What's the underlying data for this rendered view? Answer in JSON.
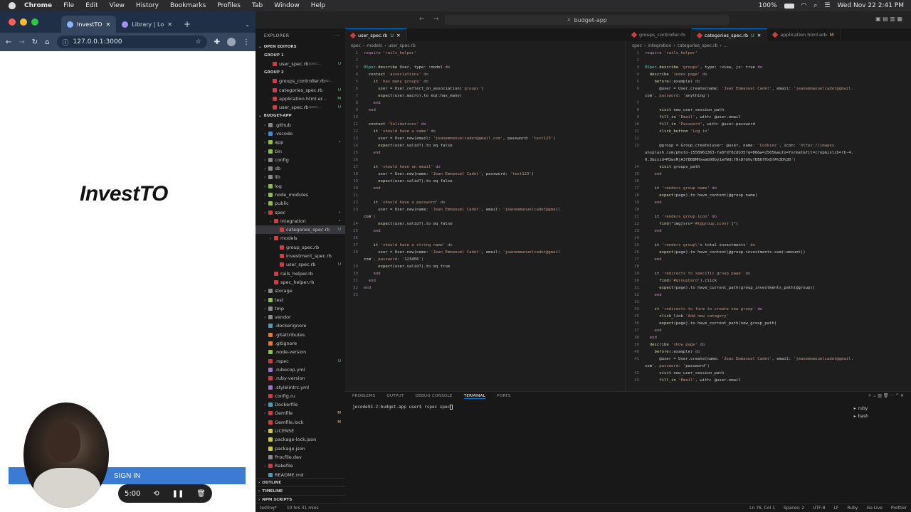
{
  "menubar": {
    "app": "Chrome",
    "items": [
      "File",
      "Edit",
      "View",
      "History",
      "Bookmarks",
      "Profiles",
      "Tab",
      "Window",
      "Help"
    ],
    "battery": "100%",
    "datetime": "Wed Nov 22  2:41 PM"
  },
  "chrome": {
    "tabs": [
      {
        "label": "InvestTO",
        "active": true
      },
      {
        "label": "Library | Lo",
        "active": false
      }
    ],
    "url": "127.0.0.1:3000",
    "page": {
      "brand": "InvestTO",
      "signin_label": "SIGN IN"
    }
  },
  "recorder": {
    "time": "5:00"
  },
  "vscode": {
    "window_title": "budget-app",
    "explorer_title": "EXPLORER",
    "open_editors_title": "OPEN EDITORS",
    "groups": [
      {
        "title": "GROUP 1",
        "files": [
          {
            "name": "user_spec.rb",
            "hint": "spec/...",
            "badge": "U"
          }
        ]
      },
      {
        "title": "GROUP 2",
        "files": [
          {
            "name": "groups_controller.rb",
            "hint": "ap...",
            "badge": ""
          },
          {
            "name": "categories_spec.rb",
            "hint": "",
            "badge": "U"
          },
          {
            "name": "application.html.er...",
            "hint": "",
            "badge": "M"
          },
          {
            "name": "user_spec.rb",
            "hint": "spec/...",
            "badge": "U"
          }
        ]
      }
    ],
    "project_title": "BUDGET-APP",
    "tree": [
      {
        "name": ".github",
        "indent": 1,
        "color": "#8a8a8a",
        "badge": ""
      },
      {
        "name": ".vscode",
        "indent": 1,
        "color": "#3f8fd6",
        "badge": ""
      },
      {
        "name": "app",
        "indent": 1,
        "color": "#8dc149",
        "badge": "•"
      },
      {
        "name": "bin",
        "indent": 1,
        "color": "#8dc149",
        "badge": ""
      },
      {
        "name": "config",
        "indent": 1,
        "color": "#8a8a8a",
        "badge": ""
      },
      {
        "name": "db",
        "indent": 1,
        "color": "#8a8a8a",
        "badge": ""
      },
      {
        "name": "lib",
        "indent": 1,
        "color": "#8a8a8a",
        "badge": ""
      },
      {
        "name": "log",
        "indent": 1,
        "color": "#8dc149",
        "badge": ""
      },
      {
        "name": "node_modules",
        "indent": 1,
        "color": "#8dc149",
        "badge": ""
      },
      {
        "name": "public",
        "indent": 1,
        "color": "#8dc149",
        "badge": ""
      },
      {
        "name": "spec",
        "indent": 1,
        "color": "#cc3e44",
        "badge": "•"
      },
      {
        "name": "integration",
        "indent": 2,
        "color": "#cc3e44",
        "badge": "•"
      },
      {
        "name": "categories_spec.rb",
        "indent": 3,
        "color": "#cc3e44",
        "badge": "U",
        "selected": true
      },
      {
        "name": "models",
        "indent": 2,
        "color": "#cc3e44",
        "badge": ""
      },
      {
        "name": "group_spec.rb",
        "indent": 3,
        "color": "#cc3e44",
        "badge": ""
      },
      {
        "name": "investment_spec.rb",
        "indent": 3,
        "color": "#cc3e44",
        "badge": ""
      },
      {
        "name": "user_spec.rb",
        "indent": 3,
        "color": "#cc3e44",
        "badge": "U"
      },
      {
        "name": "rails_helper.rb",
        "indent": 2,
        "color": "#cc3e44",
        "badge": ""
      },
      {
        "name": "spec_helper.rb",
        "indent": 2,
        "color": "#cc3e44",
        "badge": ""
      },
      {
        "name": "storage",
        "indent": 1,
        "color": "#8a8a8a",
        "badge": ""
      },
      {
        "name": "test",
        "indent": 1,
        "color": "#8dc149",
        "badge": ""
      },
      {
        "name": "tmp",
        "indent": 1,
        "color": "#8a8a8a",
        "badge": ""
      },
      {
        "name": "vendor",
        "indent": 1,
        "color": "#8a8a8a",
        "badge": ""
      },
      {
        "name": ".dockerignore",
        "indent": 1,
        "color": "#519aba",
        "badge": ""
      },
      {
        "name": ".gitattributes",
        "indent": 1,
        "color": "#e37933",
        "badge": ""
      },
      {
        "name": ".gitignore",
        "indent": 1,
        "color": "#e37933",
        "badge": ""
      },
      {
        "name": ".node-version",
        "indent": 1,
        "color": "#8dc149",
        "badge": ""
      },
      {
        "name": ".rspec",
        "indent": 1,
        "color": "#cc3e44",
        "badge": "U"
      },
      {
        "name": ".rubocop.yml",
        "indent": 1,
        "color": "#a074c4",
        "badge": ""
      },
      {
        "name": ".ruby-version",
        "indent": 1,
        "color": "#cc3e44",
        "badge": ""
      },
      {
        "name": ".stylelintrc.yml",
        "indent": 1,
        "color": "#a074c4",
        "badge": ""
      },
      {
        "name": "config.ru",
        "indent": 1,
        "color": "#cc3e44",
        "badge": ""
      },
      {
        "name": "Dockerfile",
        "indent": 1,
        "color": "#519aba",
        "badge": ""
      },
      {
        "name": "Gemfile",
        "indent": 1,
        "color": "#cc3e44",
        "badge": "M"
      },
      {
        "name": "Gemfile.lock",
        "indent": 1,
        "color": "#cc3e44",
        "badge": "M"
      },
      {
        "name": "LICENSE",
        "indent": 1,
        "color": "#cbcb41",
        "badge": ""
      },
      {
        "name": "package-lock.json",
        "indent": 1,
        "color": "#cbcb41",
        "badge": ""
      },
      {
        "name": "package.json",
        "indent": 1,
        "color": "#cbcb41",
        "badge": ""
      },
      {
        "name": "Procfile.dev",
        "indent": 1,
        "color": "#8a8a8a",
        "badge": ""
      },
      {
        "name": "Rakefile",
        "indent": 1,
        "color": "#cc3e44",
        "badge": ""
      },
      {
        "name": "README.md",
        "indent": 1,
        "color": "#519aba",
        "badge": ""
      }
    ],
    "outline_title": "OUTLINE",
    "timeline_title": "TIMELINE",
    "npm_title": "NPM SCRIPTS",
    "left_tabs": [
      {
        "label": "user_spec.rb",
        "badge": "U",
        "active": true
      }
    ],
    "right_tabs": [
      {
        "label": "groups_controller.rb",
        "badge": "",
        "active": false
      },
      {
        "label": "categories_spec.rb",
        "badge": "U",
        "active": true
      },
      {
        "label": "application.html.erb",
        "badge": "M",
        "active": false
      }
    ],
    "left_breadcrumb": [
      "spec",
      "models",
      "user_spec.rb"
    ],
    "right_breadcrumb": [
      "spec",
      "integration",
      "categories_spec.rb",
      "..."
    ],
    "left_code": [
      "require 'rails_helper'",
      "",
      "RSpec.describe User, type: :model do",
      "  context 'associations' do",
      "    it 'has many groups' do",
      "      user = User.reflect_on_association('groups')",
      "      expect(user.macro).to eq(:has_many)",
      "    end",
      "  end",
      "",
      "  context 'Validations' do",
      "    it 'should have a name' do",
      "      user = User.new(email: 'jeanemmanuelcadet@gmail.com', password: 'test123')",
      "      expect(user.valid?).to eq false",
      "    end",
      "",
      "    it 'should have an email' do",
      "      user = User.new(name: 'Jean Emmanuel Cadet', password: 'test123')",
      "      expect(user.valid?).to eq false",
      "    end",
      "",
      "    it 'should have a password' do",
      "      user = User.new(name: 'Jean Emmanuel Cadet', email: 'jeanemmanuelcadet@gmail.",
      "com')",
      "      expect(user.valid?).to eq false",
      "    end",
      "",
      "    it 'should have a string name' do",
      "      user = User.new(name: 'Jean Emmanuel Cadet', email: 'jeanemmanuelcadet@gmail.",
      "com', password: '123456')",
      "      expect(user.valid?).to eq true",
      "    end",
      "  end",
      "end",
      ""
    ],
    "left_line_numbers": [
      "1",
      "2",
      "3",
      "4",
      "5",
      "6",
      "7",
      "8",
      "9",
      "10",
      "11",
      "12",
      "13",
      "14",
      "15",
      "16",
      "17",
      "18",
      "19",
      "20",
      "21",
      "22",
      "23",
      "",
      "24",
      "25",
      "26",
      "27",
      "28",
      "",
      "29",
      "30",
      "31",
      "32",
      "33"
    ],
    "right_code": [
      "require 'rails_helper'",
      "",
      "RSpec.describe 'groups', type: :view, js: true do",
      "  describe 'index page' do",
      "    before(:example) do",
      "      @user = User.create(name: 'Jean Emmanuel Cadet', email: 'jeanemmanuelcadet@gmail.",
      "com', password: 'anything')",
      "",
      "      visit new_user_session_path",
      "      fill_in 'Email', with: @user.email",
      "      fill_in 'Password', with: @user.password",
      "      click_button 'Log in'",
      "",
      "      @group = Group.create(user: @user, name: 'Cookies', icon: 'https://images.",
      "unsplash.com/photo-1558961363-fa8fdf82db35?q=80&w=2565&auto=format&fit=crop&ixlib=rb-4.",
      "0.3&ixid=M3wxMjA3fDB8MHxwaG90by1wYWdlfHx8fGVufDB8fHx8fA%3D%3D')",
      "      visit groups_path",
      "    end",
      "",
      "    it 'renders group name' do",
      "      expect(page).to have_content(@group.name)",
      "    end",
      "",
      "    it 'renders group icon' do",
      "      find(\"img[src='#{@group.icon}']\")",
      "    end",
      "",
      "    it 'renders group\\'s total investments' do",
      "      expect(page).to have_content(@group.investments.sum(:amount))",
      "    end",
      "",
      "    it 'redirects to specific group page' do",
      "      find('#groupCard').click",
      "      expect(page).to have_current_path(group_investments_path(@group))",
      "    end",
      "",
      "    it 'redirects to form to create new group' do",
      "      click_link 'Add new category'",
      "      expect(page).to have_current_path(new_group_path)",
      "    end",
      "  end",
      "  describe 'show page' do",
      "    before(:example) do",
      "      @user = User.create(name: 'Jean Emmanuel Cadet', email: 'jeanemmanuelcadet@gmail.",
      "com', password: 'password')",
      "      visit new_user_session_path",
      "      fill_in 'Email', with: @user.email"
    ],
    "right_line_numbers": [
      "1",
      "2",
      "3",
      "4",
      "5",
      "6",
      "",
      "7",
      "8",
      "9",
      "10",
      "11",
      "12",
      "13",
      "",
      "",
      "14",
      "15",
      "16",
      "17",
      "18",
      "19",
      "20",
      "21",
      "22",
      "23",
      "24",
      "25",
      "26",
      "27",
      "28",
      "29",
      "30",
      "31",
      "32",
      "33",
      "34",
      "35",
      "36",
      "37",
      "38",
      "39",
      "40",
      "41",
      "",
      "42",
      "43"
    ],
    "panel_tabs": [
      "PROBLEMS",
      "OUTPUT",
      "DEBUG CONSOLE",
      "TERMINAL",
      "PORTS"
    ],
    "active_panel_tab": "TERMINAL",
    "terminal_prompt": "jecode93-2:budget-app user$ rspec spec",
    "terminals": [
      "ruby",
      "bash"
    ],
    "status": {
      "left": "testing*",
      "time_tracked": "10 hrs 31 mins",
      "cursor": "Ln 76, Col 1",
      "spaces": "Spaces: 2",
      "encoding": "UTF-8",
      "eol": "LF",
      "language": "Ruby",
      "golive": "Go Live",
      "prettier": "Prettier"
    }
  }
}
